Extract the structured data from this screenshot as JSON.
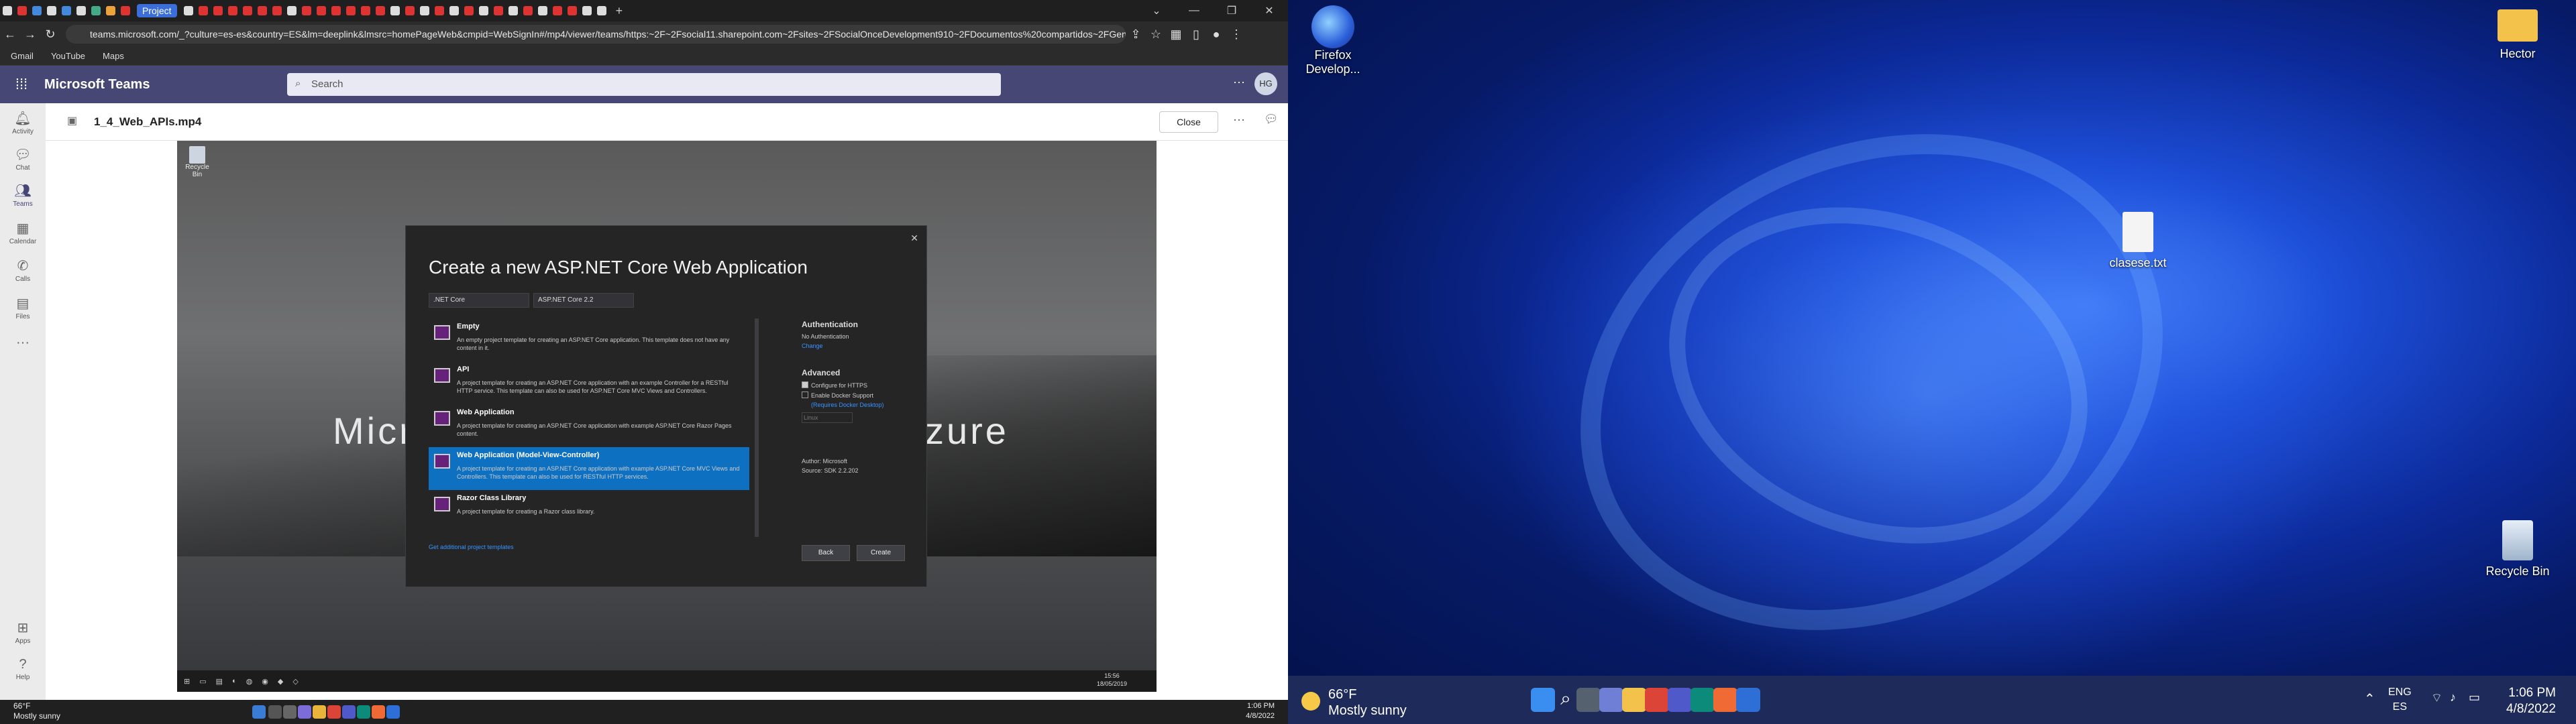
{
  "browser": {
    "tab_project_label": "Project",
    "url": "teams.microsoft.com/_?culture=es-es&country=ES&lm=deeplink&lmsrc=homePageWeb&cmpid=WebSignIn#/mp4/viewer/teams/https:~2F~2Fsocial11.sharepoint.com~2Fsites~2FSocialOnceDevelopment910~2FDocumentos%20compartidos~2FGener...",
    "bookmarks": [
      "Gmail",
      "YouTube",
      "Maps"
    ]
  },
  "teams": {
    "app_name": "Microsoft Teams",
    "search_placeholder": "Search",
    "avatar_initials": "HG",
    "rail": [
      "Activity",
      "Chat",
      "Teams",
      "Calendar",
      "Calls",
      "Files",
      "Apps",
      "Help"
    ],
    "file_name": "1_4_Web_APIs.mp4",
    "close_label": "Close"
  },
  "video": {
    "recycle_label": "Recycle Bin",
    "big_title_left": "Micr",
    "big_title_right": "zure",
    "clock_time": "15:56",
    "clock_date": "18/05/2019",
    "dialog": {
      "title": "Create a new ASP.NET Core Web Application",
      "framework": ".NET Core",
      "version": "ASP.NET Core 2.2",
      "templates": [
        {
          "name": "Empty",
          "desc": "An empty project template for creating an ASP.NET Core application. This template does not have any content in it."
        },
        {
          "name": "API",
          "desc": "A project template for creating an ASP.NET Core application with an example Controller for a RESTful HTTP service. This template can also be used for ASP.NET Core MVC Views and Controllers."
        },
        {
          "name": "Web Application",
          "desc": "A project template for creating an ASP.NET Core application with example ASP.NET Core Razor Pages content."
        },
        {
          "name": "Web Application (Model-View-Controller)",
          "desc": "A project template for creating an ASP.NET Core application with example ASP.NET Core MVC Views and Controllers. This template can also be used for RESTful HTTP services."
        },
        {
          "name": "Razor Class Library",
          "desc": "A project template for creating a Razor class library."
        }
      ],
      "additional_link": "Get additional project templates",
      "auth_heading": "Authentication",
      "auth_value": "No Authentication",
      "auth_change": "Change",
      "advanced_heading": "Advanced",
      "https_label": "Configure for HTTPS",
      "docker_label": "Enable Docker Support",
      "docker_requires": "(Requires Docker Desktop)",
      "docker_os": "Linux",
      "author": "Author: Microsoft",
      "source": "Source: SDK 2.2.202",
      "back_label": "Back",
      "create_label": "Create"
    }
  },
  "left_taskbar": {
    "temp": "66°F",
    "weather": "Mostly sunny",
    "time": "1:06 PM",
    "date": "4/8/2022"
  },
  "desktop": {
    "icons": {
      "firefox": "Firefox Develop...",
      "folder": "Hector",
      "file": "clasese.txt",
      "recycle": "Recycle Bin"
    },
    "taskbar": {
      "temp": "66°F",
      "weather": "Mostly sunny",
      "lang1": "ENG",
      "lang2": "ES",
      "time": "1:06 PM",
      "date": "4/8/2022"
    }
  },
  "colors": {
    "teams_purple": "#464775",
    "selected_blue": "#0e70c0"
  }
}
